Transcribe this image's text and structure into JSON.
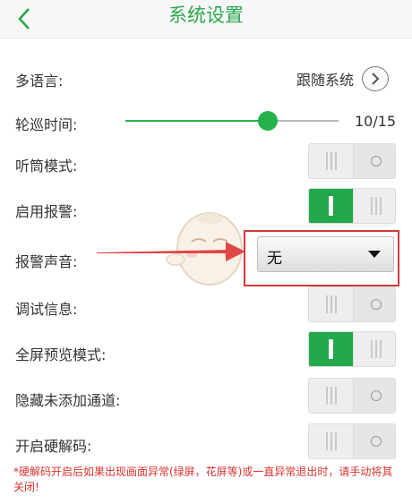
{
  "header": {
    "title": "系统设置"
  },
  "settings": {
    "language": {
      "label": "多语言:",
      "value": "跟随系统"
    },
    "patrol": {
      "label": "轮巡时间:",
      "value_text": "10/15",
      "current": 10,
      "max": 15
    },
    "earpiece": {
      "label": "听筒模式:",
      "on": false
    },
    "alarm": {
      "label": "启用报警:",
      "on": true
    },
    "alarm_sound": {
      "label": "报警声音:",
      "selected": "无"
    },
    "debug": {
      "label": "调试信息:",
      "on": false
    },
    "fullscreen": {
      "label": "全屏预览模式:",
      "on": true
    },
    "hide_channels": {
      "label": "隐藏未添加通道:",
      "on": false
    },
    "hw_decode": {
      "label": "开启硬解码:",
      "on": false
    }
  },
  "note": "*硬解码开启后如果出现画面异常(绿屏，花屏等)或一直异常退出时，请手动将其关闭!",
  "colors": {
    "accent": "#22a84a",
    "highlight": "#d33a3a",
    "note": "#d8332f"
  }
}
